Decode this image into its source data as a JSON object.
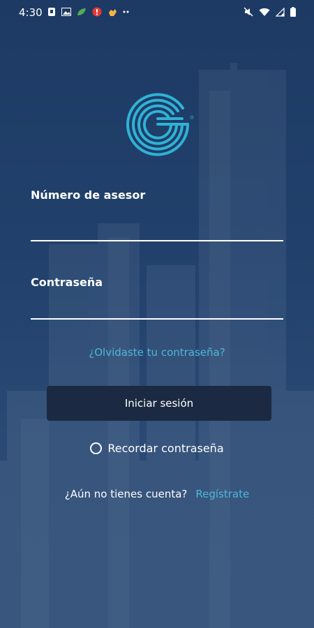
{
  "status_bar": {
    "time": "4:30",
    "left_icons": [
      "shield-icon",
      "image-icon",
      "leaf-icon",
      "alert-badge-icon",
      "hand-icon",
      "more-dots-icon"
    ],
    "right_icons": [
      "mute-icon",
      "wifi-icon",
      "signal-icon",
      "battery-icon"
    ]
  },
  "form": {
    "advisor_label": "Número de asesor",
    "advisor_value": "",
    "password_label": "Contraseña",
    "password_value": "",
    "forgot_link": "¿Olvidaste tu contraseña?",
    "login_button": "Iniciar sesión",
    "remember_label": "Recordar contraseña",
    "remember_checked": false,
    "no_account_text": "¿Aún no tienes cuenta?",
    "register_link": "Regístrate"
  },
  "colors": {
    "background": "#1f3d66",
    "accent": "#4fb6d8",
    "button": "#1b2a42",
    "text": "#ffffff"
  }
}
